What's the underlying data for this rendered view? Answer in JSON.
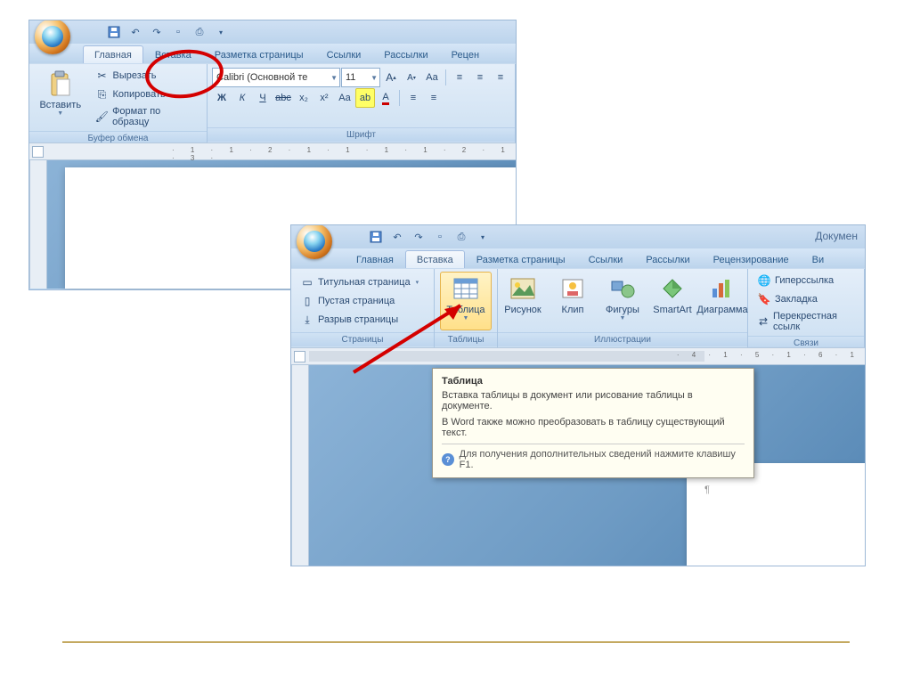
{
  "shot1": {
    "tabs": [
      "Главная",
      "Вставка",
      "Разметка страницы",
      "Ссылки",
      "Рассылки",
      "Рецен"
    ],
    "active_tab": 0,
    "circled_tab": 1,
    "paste_label": "Вставить",
    "clipboard": {
      "cut": "Вырезать",
      "copy": "Копировать",
      "format": "Формат по образцу",
      "group": "Буфер обмена"
    },
    "font": {
      "name": "Calibri (Основной те",
      "size": "11",
      "group": "Шрифт"
    }
  },
  "shot2": {
    "doc_title": "Докумен",
    "tabs": [
      "Главная",
      "Вставка",
      "Разметка страницы",
      "Ссылки",
      "Рассылки",
      "Рецензирование",
      "Ви"
    ],
    "active_tab": 1,
    "pages": {
      "title": "Титульная страница",
      "blank": "Пустая страница",
      "break": "Разрыв страницы",
      "group": "Страницы"
    },
    "table": {
      "label": "Таблица",
      "group": "Таблицы"
    },
    "illus": {
      "pic": "Рисунок",
      "clip": "Клип",
      "shapes": "Фигуры",
      "smartart": "SmartArt",
      "chart": "Диаграмма",
      "group": "Иллюстрации"
    },
    "links": {
      "hyper": "Гиперссылка",
      "bookmark": "Закладка",
      "cross": "Перекрестная ссылк",
      "group": "Связи"
    },
    "tooltip": {
      "title": "Таблица",
      "line1": "Вставка таблицы в документ или рисование таблицы в документе.",
      "line2": "В Word также можно преобразовать в таблицу существующий текст.",
      "footer": "Для получения дополнительных сведений нажмите клавишу F1."
    }
  }
}
